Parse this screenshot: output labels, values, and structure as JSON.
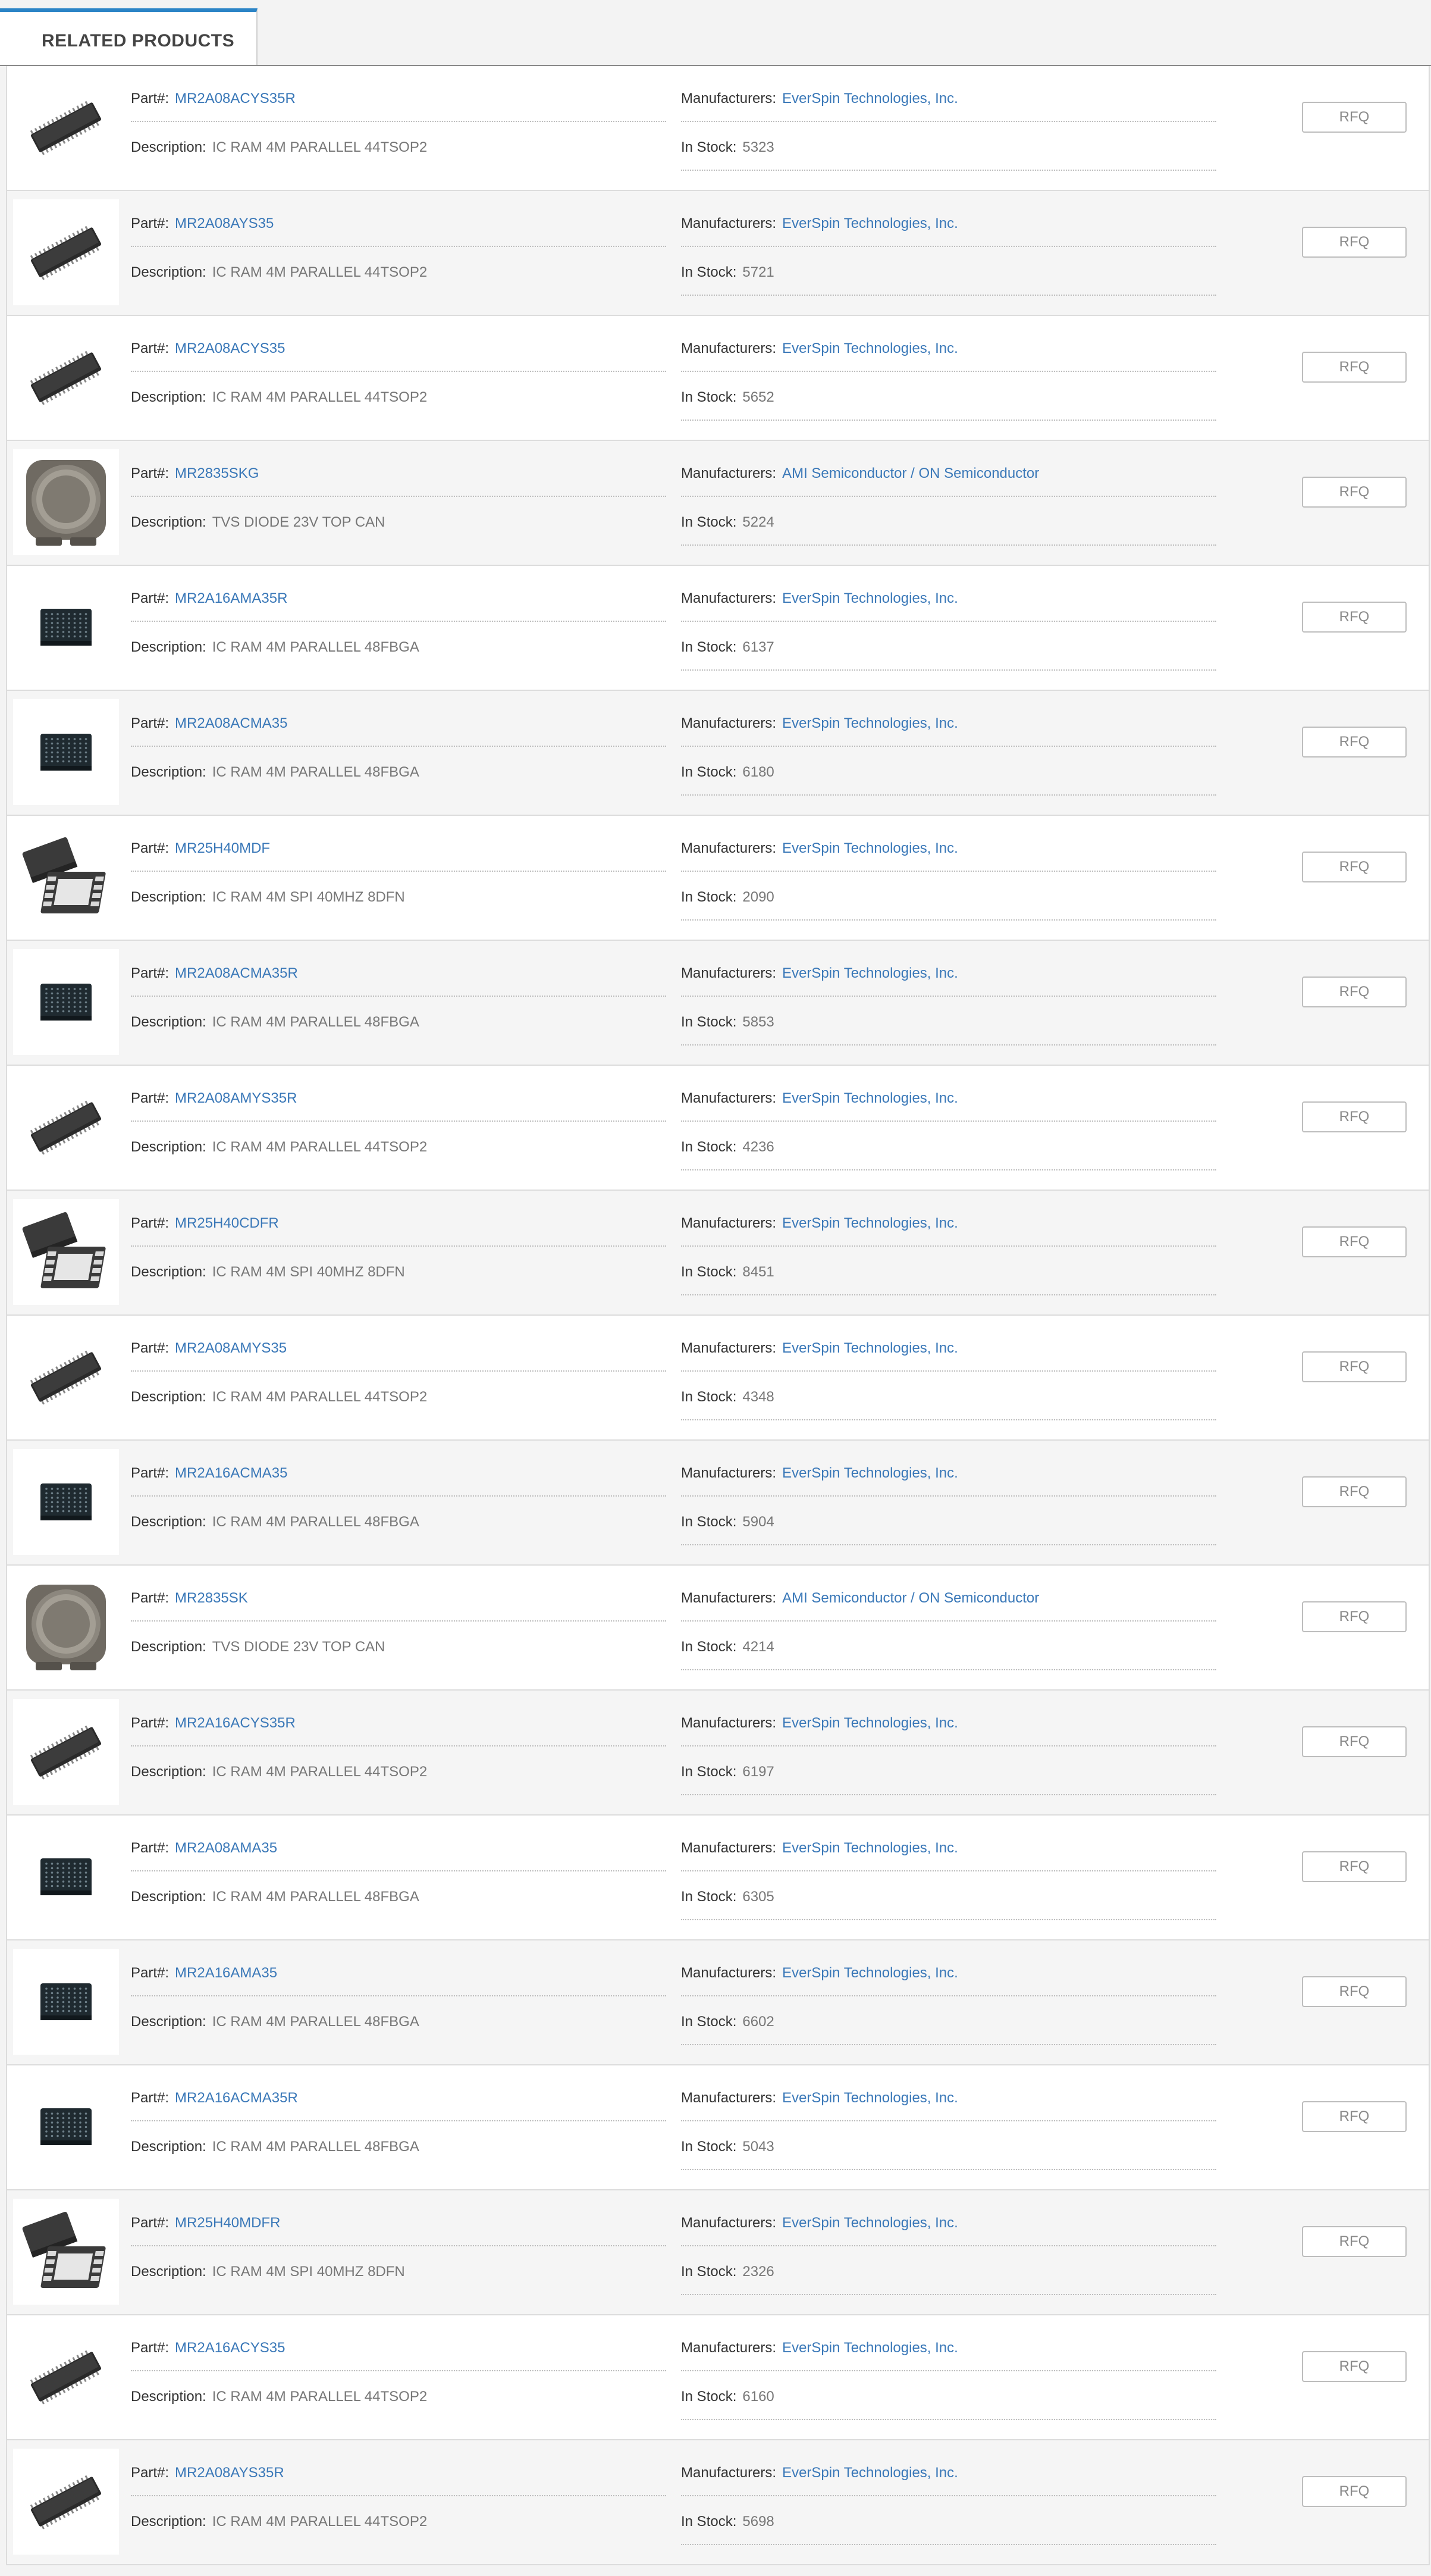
{
  "tab": {
    "label": "RELATED PRODUCTS"
  },
  "labels": {
    "part": "Part#:",
    "description": "Description:",
    "manufacturers": "Manufacturers:",
    "in_stock": "In Stock:",
    "rfq": "RFQ"
  },
  "products": [
    {
      "part": "MR2A08ACYS35R",
      "description": "IC RAM 4M PARALLEL 44TSOP2",
      "manufacturer": "EverSpin Technologies, Inc.",
      "stock": "5323",
      "image": "tsop-chip-icon"
    },
    {
      "part": "MR2A08AYS35",
      "description": "IC RAM 4M PARALLEL 44TSOP2",
      "manufacturer": "EverSpin Technologies, Inc.",
      "stock": "5721",
      "image": "tsop-chip-icon"
    },
    {
      "part": "MR2A08ACYS35",
      "description": "IC RAM 4M PARALLEL 44TSOP2",
      "manufacturer": "EverSpin Technologies, Inc.",
      "stock": "5652",
      "image": "tsop-chip-icon"
    },
    {
      "part": "MR2835SKG",
      "description": "TVS DIODE 23V TOP CAN",
      "manufacturer": "AMI Semiconductor / ON Semiconductor",
      "stock": "5224",
      "image": "can-diode-icon"
    },
    {
      "part": "MR2A16AMA35R",
      "description": "IC RAM 4M PARALLEL 48FBGA",
      "manufacturer": "EverSpin Technologies, Inc.",
      "stock": "6137",
      "image": "bga-chip-icon"
    },
    {
      "part": "MR2A08ACMA35",
      "description": "IC RAM 4M PARALLEL 48FBGA",
      "manufacturer": "EverSpin Technologies, Inc.",
      "stock": "6180",
      "image": "bga-chip-icon"
    },
    {
      "part": "MR25H40MDF",
      "description": "IC RAM 4M SPI 40MHZ 8DFN",
      "manufacturer": "EverSpin Technologies, Inc.",
      "stock": "2090",
      "image": "dfn-chip-icon"
    },
    {
      "part": "MR2A08ACMA35R",
      "description": "IC RAM 4M PARALLEL 48FBGA",
      "manufacturer": "EverSpin Technologies, Inc.",
      "stock": "5853",
      "image": "bga-chip-icon"
    },
    {
      "part": "MR2A08AMYS35R",
      "description": "IC RAM 4M PARALLEL 44TSOP2",
      "manufacturer": "EverSpin Technologies, Inc.",
      "stock": "4236",
      "image": "tsop-chip-icon"
    },
    {
      "part": "MR25H40CDFR",
      "description": "IC RAM 4M SPI 40MHZ 8DFN",
      "manufacturer": "EverSpin Technologies, Inc.",
      "stock": "8451",
      "image": "dfn-chip-icon"
    },
    {
      "part": "MR2A08AMYS35",
      "description": "IC RAM 4M PARALLEL 44TSOP2",
      "manufacturer": "EverSpin Technologies, Inc.",
      "stock": "4348",
      "image": "tsop-chip-icon"
    },
    {
      "part": "MR2A16ACMA35",
      "description": "IC RAM 4M PARALLEL 48FBGA",
      "manufacturer": "EverSpin Technologies, Inc.",
      "stock": "5904",
      "image": "bga-chip-icon"
    },
    {
      "part": "MR2835SK",
      "description": "TVS DIODE 23V TOP CAN",
      "manufacturer": "AMI Semiconductor / ON Semiconductor",
      "stock": "4214",
      "image": "can-diode-icon"
    },
    {
      "part": "MR2A16ACYS35R",
      "description": "IC RAM 4M PARALLEL 44TSOP2",
      "manufacturer": "EverSpin Technologies, Inc.",
      "stock": "6197",
      "image": "tsop-chip-icon"
    },
    {
      "part": "MR2A08AMA35",
      "description": "IC RAM 4M PARALLEL 48FBGA",
      "manufacturer": "EverSpin Technologies, Inc.",
      "stock": "6305",
      "image": "bga-chip-icon"
    },
    {
      "part": "MR2A16AMA35",
      "description": "IC RAM 4M PARALLEL 48FBGA",
      "manufacturer": "EverSpin Technologies, Inc.",
      "stock": "6602",
      "image": "bga-chip-icon"
    },
    {
      "part": "MR2A16ACMA35R",
      "description": "IC RAM 4M PARALLEL 48FBGA",
      "manufacturer": "EverSpin Technologies, Inc.",
      "stock": "5043",
      "image": "bga-chip-icon"
    },
    {
      "part": "MR25H40MDFR",
      "description": "IC RAM 4M SPI 40MHZ 8DFN",
      "manufacturer": "EverSpin Technologies, Inc.",
      "stock": "2326",
      "image": "dfn-chip-icon"
    },
    {
      "part": "MR2A16ACYS35",
      "description": "IC RAM 4M PARALLEL 44TSOP2",
      "manufacturer": "EverSpin Technologies, Inc.",
      "stock": "6160",
      "image": "tsop-chip-icon"
    },
    {
      "part": "MR2A08AYS35R",
      "description": "IC RAM 4M PARALLEL 44TSOP2",
      "manufacturer": "EverSpin Technologies, Inc.",
      "stock": "5698",
      "image": "tsop-chip-icon"
    }
  ]
}
